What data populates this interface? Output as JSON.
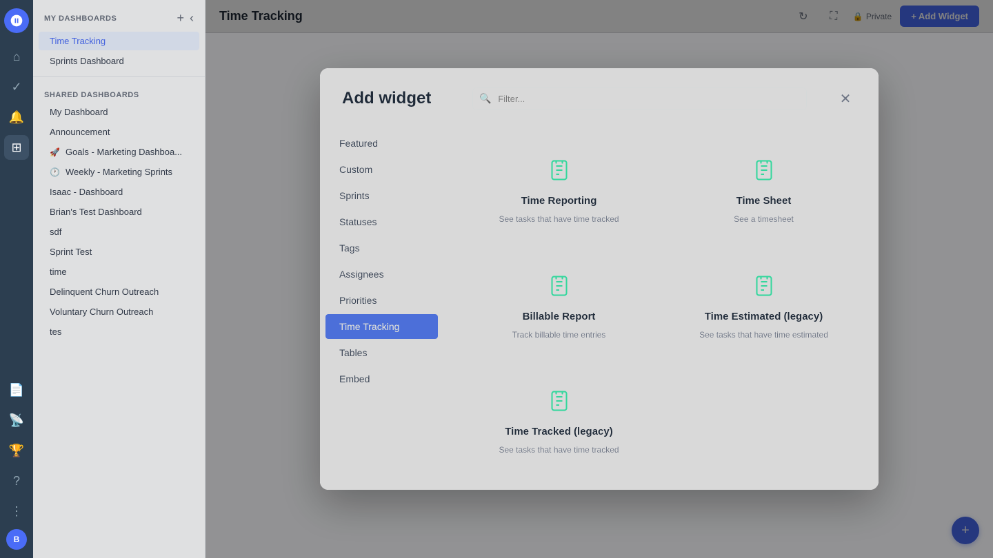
{
  "app": {
    "logo": "🚀"
  },
  "navRail": {
    "icons": [
      {
        "name": "home-icon",
        "symbol": "⌂",
        "active": false
      },
      {
        "name": "tasks-icon",
        "symbol": "✓",
        "active": false
      },
      {
        "name": "inbox-icon",
        "symbol": "🔔",
        "active": false
      },
      {
        "name": "dashboard-icon",
        "symbol": "⊞",
        "active": true
      },
      {
        "name": "docs-icon",
        "symbol": "📄",
        "active": false
      },
      {
        "name": "pulse-icon",
        "symbol": "📡",
        "active": false
      },
      {
        "name": "goals-icon",
        "symbol": "🏆",
        "active": false
      },
      {
        "name": "help-icon",
        "symbol": "?",
        "active": false
      },
      {
        "name": "more-icon",
        "symbol": "⋮",
        "active": false
      }
    ]
  },
  "sidebar": {
    "myDashboardsLabel": "MY DASHBOARDS",
    "myDashboardItems": [
      {
        "label": "Time Tracking",
        "active": true
      },
      {
        "label": "Sprints Dashboard",
        "active": false
      }
    ],
    "sharedDashboardsLabel": "SHARED DASHBOARDS",
    "sharedDashboardItems": [
      {
        "label": "My Dashboard"
      },
      {
        "label": "Announcement"
      },
      {
        "label": "Goals - Marketing Dashboa..."
      },
      {
        "label": "Weekly - Marketing Sprints"
      },
      {
        "label": "Isaac - Dashboard"
      },
      {
        "label": "Brian's Test Dashboard"
      },
      {
        "label": "sdf"
      },
      {
        "label": "Sprint Test"
      },
      {
        "label": "time"
      },
      {
        "label": "Delinquent Churn Outreach"
      },
      {
        "label": "Voluntary Churn Outreach"
      },
      {
        "label": "tes"
      }
    ]
  },
  "topbar": {
    "title": "Time Tracking",
    "privateLabel": "Private",
    "addWidgetLabel": "+ Add Widget"
  },
  "modal": {
    "title": "Add widget",
    "searchPlaceholder": "Filter...",
    "categories": [
      {
        "label": "Featured",
        "active": false
      },
      {
        "label": "Custom",
        "active": false
      },
      {
        "label": "Sprints",
        "active": false
      },
      {
        "label": "Statuses",
        "active": false
      },
      {
        "label": "Tags",
        "active": false
      },
      {
        "label": "Assignees",
        "active": false
      },
      {
        "label": "Priorities",
        "active": false
      },
      {
        "label": "Time Tracking",
        "active": true
      },
      {
        "label": "Tables",
        "active": false
      },
      {
        "label": "Embed",
        "active": false
      }
    ],
    "widgets": [
      {
        "title": "Time Reporting",
        "description": "See tasks that have time tracked",
        "iconName": "time-reporting-icon"
      },
      {
        "title": "Time Sheet",
        "description": "See a timesheet",
        "iconName": "time-sheet-icon"
      },
      {
        "title": "Billable Report",
        "description": "Track billable time entries",
        "iconName": "billable-report-icon"
      },
      {
        "title": "Time Estimated (legacy)",
        "description": "See tasks that have time estimated",
        "iconName": "time-estimated-icon"
      },
      {
        "title": "Time Tracked (legacy)",
        "description": "See tasks that have time tracked",
        "iconName": "time-tracked-icon"
      }
    ]
  },
  "colors": {
    "accent": "#4a6cf7",
    "widgetIcon": "#34d399",
    "activeCategory": "#4a6cf7"
  }
}
